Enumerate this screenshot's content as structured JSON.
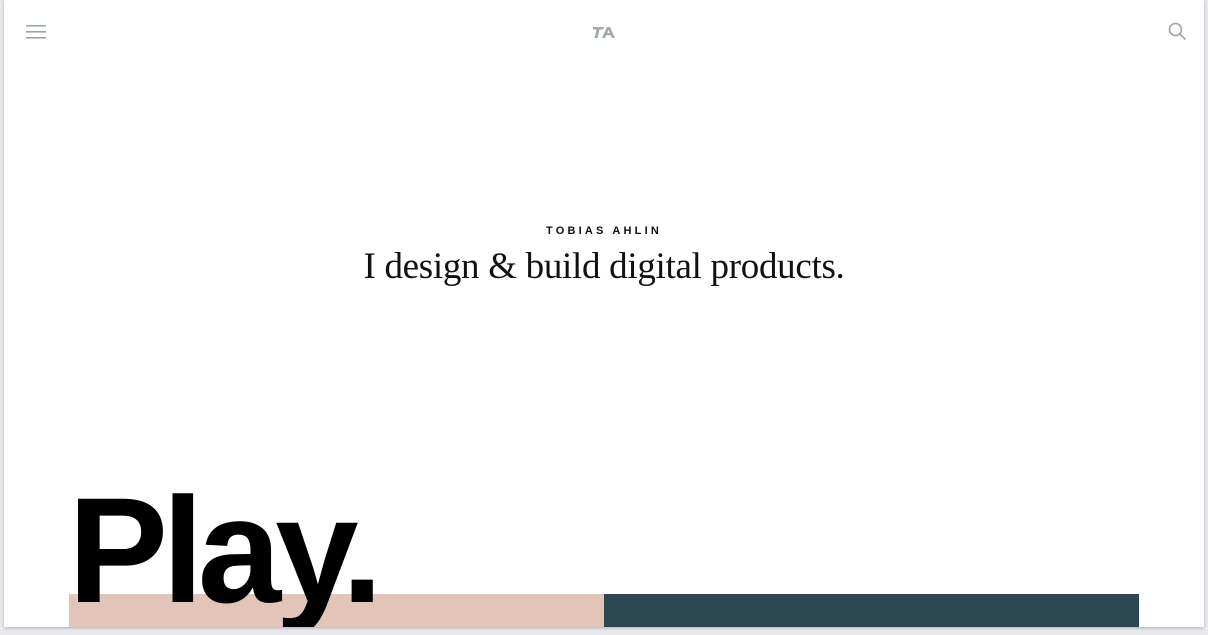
{
  "header": {
    "menu_icon": "hamburger-menu-icon",
    "logo_icon": "ta-monogram-logo",
    "search_icon": "search-icon"
  },
  "hero": {
    "name": "TOBIAS AHLIN",
    "tagline": "I design & build digital products."
  },
  "section": {
    "heading": "Play."
  },
  "colors": {
    "background": "#ffffff",
    "text": "#111111",
    "icon": "#9ea3ab",
    "card_pink": "#e3c4b9",
    "card_dark": "#2e4853"
  }
}
